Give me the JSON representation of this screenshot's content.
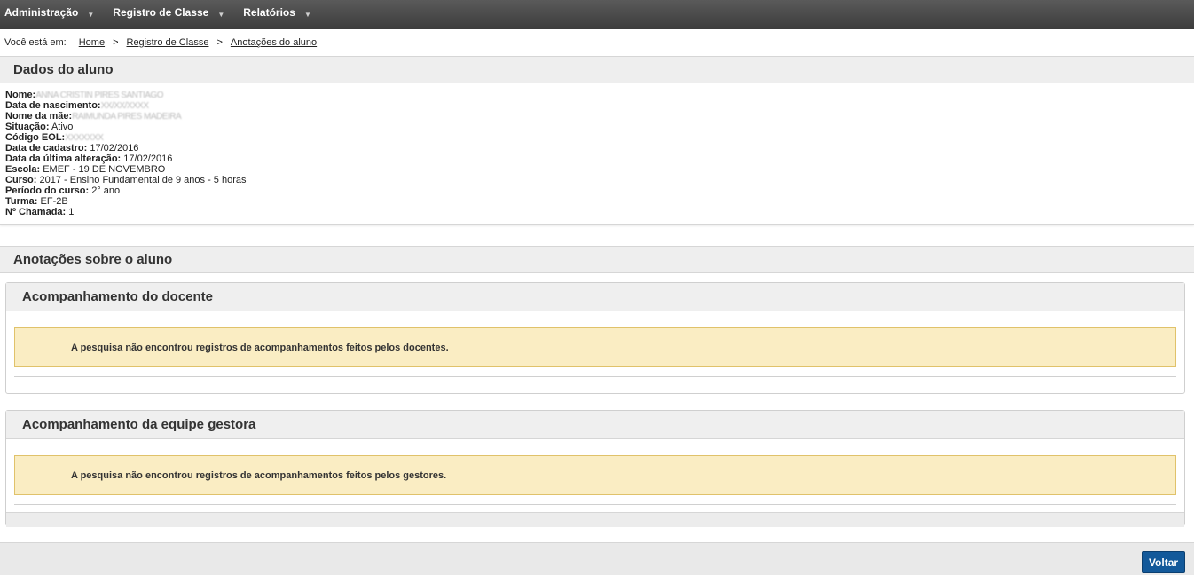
{
  "menu": [
    {
      "label": "Administração"
    },
    {
      "label": "Registro de Classe"
    },
    {
      "label": "Relatórios"
    }
  ],
  "breadcrumb": {
    "prefix": "Você está em:",
    "items": [
      "Home",
      "Registro de Classe",
      "Anotações do aluno"
    ]
  },
  "dados": {
    "title": "Dados do aluno",
    "fields": [
      {
        "label": "Nome:",
        "value": "ANNA CRISTIN PIRES SANTIAGO",
        "redacted": true
      },
      {
        "label": "Data de nascimento:",
        "value": "XX/XX/XXXX",
        "redacted": true
      },
      {
        "label": "Nome da mãe:",
        "value": "RAIMUNDA PIRES MADEIRA",
        "redacted": true
      },
      {
        "label": "Situação:",
        "value": "Ativo"
      },
      {
        "label": "Código EOL:",
        "value": "XXXXXXX",
        "redacted": true
      },
      {
        "label": "Data de cadastro:",
        "value": "17/02/2016"
      },
      {
        "label": "Data da última alteração:",
        "value": "17/02/2016"
      },
      {
        "label": "Escola:",
        "value": "EMEF - 19 DE NOVEMBRO"
      },
      {
        "label": "Curso:",
        "value": "2017 - Ensino Fundamental de 9 anos - 5 horas"
      },
      {
        "label": "Período do curso:",
        "value": "2° ano"
      },
      {
        "label": "Turma:",
        "value": "EF-2B"
      },
      {
        "label": "Nº Chamada:",
        "value": "1"
      }
    ]
  },
  "anotacoes": {
    "title": "Anotações sobre o aluno",
    "docente": {
      "title": "Acompanhamento do docente",
      "message": "A pesquisa não encontrou registros de acompanhamentos feitos pelos docentes."
    },
    "gestora": {
      "title": "Acompanhamento da equipe gestora",
      "message": "A pesquisa não encontrou registros de acompanhamentos feitos pelos gestores."
    }
  },
  "footer": {
    "back_label": "Voltar"
  }
}
